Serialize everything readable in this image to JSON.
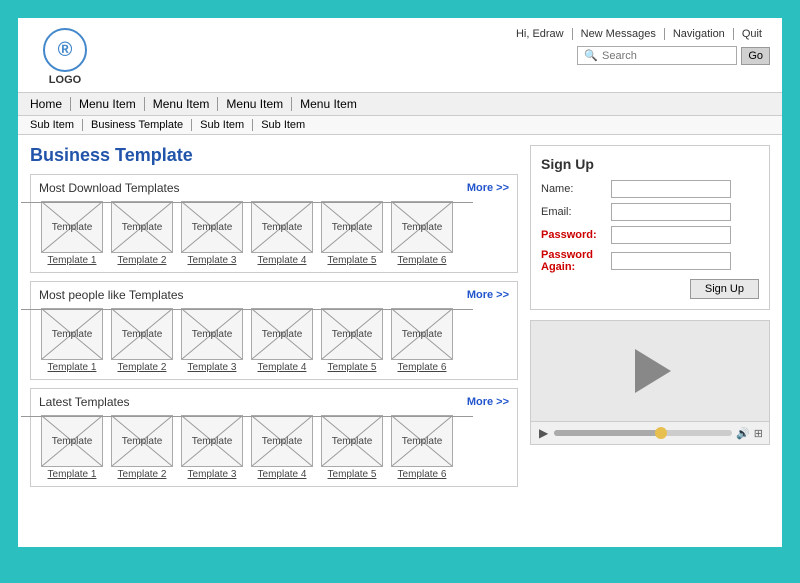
{
  "header": {
    "logo_symbol": "®",
    "logo_text": "LOGO",
    "top_links": [
      "Hi, Edraw",
      "New Messages",
      "Navigation",
      "Quit"
    ],
    "search_placeholder": "Search",
    "go_label": "Go"
  },
  "nav": {
    "primary": [
      "Home",
      "Menu Item",
      "Menu Item",
      "Menu Item",
      "Menu Item"
    ],
    "secondary": [
      "Sub Item",
      "Business Template",
      "Sub Item",
      "Sub Item"
    ]
  },
  "page": {
    "title": "Business Template"
  },
  "sections": [
    {
      "id": "most-download",
      "title": "Most Download Templates",
      "more": "More >>",
      "templates": [
        {
          "label": "Template",
          "sub": "Template 1"
        },
        {
          "label": "Template",
          "sub": "Template 2"
        },
        {
          "label": "Template",
          "sub": "Template 3"
        },
        {
          "label": "Template",
          "sub": "Template 4"
        },
        {
          "label": "Template",
          "sub": "Template 5"
        },
        {
          "label": "Template",
          "sub": "Template 6"
        }
      ]
    },
    {
      "id": "most-liked",
      "title": "Most people like Templates",
      "more": "More >>",
      "templates": [
        {
          "label": "Template",
          "sub": "Template 1"
        },
        {
          "label": "Template",
          "sub": "Template 2"
        },
        {
          "label": "Template",
          "sub": "Template 3"
        },
        {
          "label": "Template",
          "sub": "Template 4"
        },
        {
          "label": "Template",
          "sub": "Template 5"
        },
        {
          "label": "Template",
          "sub": "Template 6"
        }
      ]
    },
    {
      "id": "latest",
      "title": "Latest Templates",
      "more": "More >>",
      "templates": [
        {
          "label": "Template",
          "sub": "Template 1"
        },
        {
          "label": "Template",
          "sub": "Template 2"
        },
        {
          "label": "Template",
          "sub": "Template 3"
        },
        {
          "label": "Template",
          "sub": "Template 4"
        },
        {
          "label": "Template",
          "sub": "Template 5"
        },
        {
          "label": "Template",
          "sub": "Template 6"
        }
      ]
    }
  ],
  "signup": {
    "title": "Sign Up",
    "fields": [
      {
        "label": "Name:",
        "type": "text",
        "red": false
      },
      {
        "label": "Email:",
        "type": "text",
        "red": false
      },
      {
        "label": "Password:",
        "type": "password",
        "red": true
      },
      {
        "label": "Password Again:",
        "type": "password",
        "red": true
      }
    ],
    "button": "Sign Up"
  },
  "video": {
    "progress_pct": 60
  }
}
